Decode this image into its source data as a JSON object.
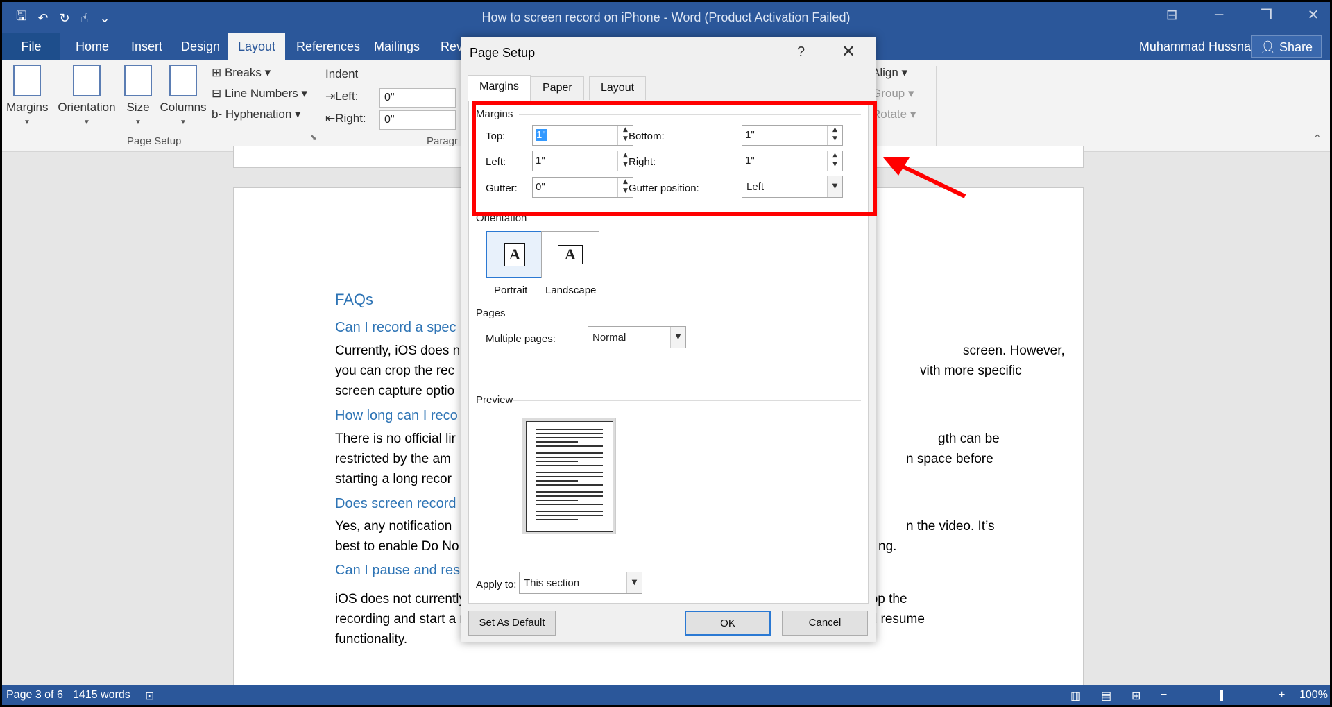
{
  "window": {
    "title": "How to screen record on iPhone - Word (Product Activation Failed)",
    "qat_icons": [
      "save-icon",
      "undo-icon",
      "redo-icon",
      "touch-mode-icon",
      "customize-qat-icon"
    ]
  },
  "tabs": [
    "File",
    "Home",
    "Insert",
    "Design",
    "Layout",
    "References",
    "Mailings",
    "Revi"
  ],
  "active_tab": "Layout",
  "user": "Muhammad Hussnain",
  "share_label": "Share",
  "ribbon": {
    "margins": "Margins",
    "orientation": "Orientation",
    "size": "Size",
    "columns": "Columns",
    "breaks": "Breaks",
    "line_numbers": "Line Numbers",
    "hyphenation": "Hyphenation",
    "group_page_setup": "Page Setup",
    "indent": "Indent",
    "left_label": "Left:",
    "left_value": "0\"",
    "right_label": "Right:",
    "right_value": "0\"",
    "group_paragraph": "Paragr",
    "align": "Align",
    "group": "Group",
    "rotate": "Rotate"
  },
  "document": {
    "h_faqs": "FAQs",
    "q1": "Can I record a spec",
    "p1_l1a": "Currently, iOS does n",
    "p1_l1b": "screen. However,",
    "p1_l2a": "you can crop the rec",
    "p1_l2b": "vith more specific",
    "p1_l3": "screen capture optio",
    "q2": "How long can I reco",
    "p2_l1a": "There is no official lir",
    "p2_l1b": "gth can be",
    "p2_l2a": "restricted by the am",
    "p2_l2b": "n space before",
    "p2_l3": "starting a long recor",
    "q3": "Does screen record",
    "p3_l1a": "Yes, any notification",
    "p3_l1b": "n the video. It’s",
    "p3_l2a": "best to enable Do No",
    "p3_l2b": "ng.",
    "q4": "Can I pause and res",
    "p4_l1": "iOS does not currently offer the ability to pause and resume a screen recording. You must stop the",
    "p4_l2": "recording and start a new one if needed, though some third-party apps might offer pause and resume",
    "p4_l3": "functionality."
  },
  "status": {
    "page": "Page 3 of 6",
    "words": "1415 words",
    "zoom": "100%"
  },
  "dialog": {
    "title": "Page Setup",
    "help": "?",
    "tabs": [
      "Margins",
      "Paper",
      "Layout"
    ],
    "margins_section": "Margins",
    "top_label": "Top:",
    "top_value": "1\"",
    "bottom_label": "Bottom:",
    "bottom_value": "1\"",
    "left_label": "Left:",
    "left_value": "1\"",
    "right_label": "Right:",
    "right_value": "1\"",
    "gutter_label": "Gutter:",
    "gutter_value": "0\"",
    "gutter_pos_label": "Gutter position:",
    "gutter_pos_value": "Left",
    "orientation_section": "Orientation",
    "portrait": "Portrait",
    "landscape": "Landscape",
    "pages_section": "Pages",
    "multiple_pages_label": "Multiple pages:",
    "multiple_pages_value": "Normal",
    "preview_section": "Preview",
    "apply_to_label": "Apply to:",
    "apply_to_value": "This section",
    "set_default": "Set As Default",
    "ok": "OK",
    "cancel": "Cancel"
  },
  "colors": {
    "accent": "#2b579a",
    "highlight": "#ff0000"
  }
}
